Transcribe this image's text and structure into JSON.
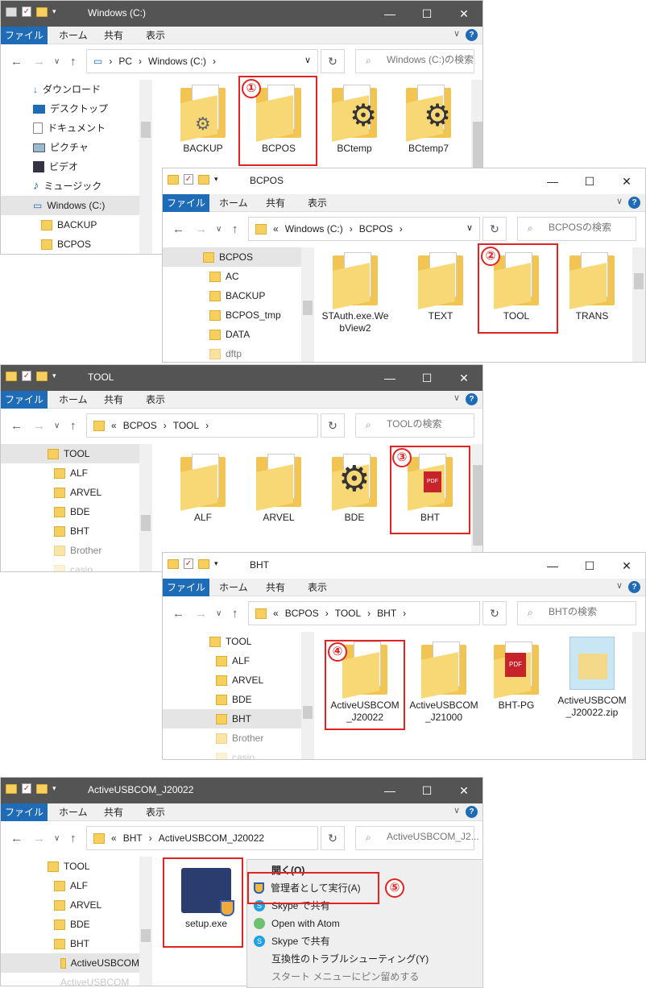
{
  "windows": [
    {
      "title": "Windows (C:)",
      "ribbon": [
        "ファイル",
        "ホーム",
        "共有",
        "表示"
      ],
      "path": [
        "PC",
        "Windows (C:)"
      ],
      "search_placeholder": "Windows (C:)の検索",
      "sidebar": [
        "ダウンロード",
        "デスクトップ",
        "ドキュメント",
        "ピクチャ",
        "ビデオ",
        "ミュージック",
        "Windows (C:)",
        "BACKUP",
        "BCPOS"
      ],
      "items": [
        "BACKUP",
        "BCPOS",
        "BCtemp",
        "BCtemp7"
      ]
    },
    {
      "title": "BCPOS",
      "ribbon": [
        "ファイル",
        "ホーム",
        "共有",
        "表示"
      ],
      "path": [
        "Windows (C:)",
        "BCPOS"
      ],
      "search_placeholder": "BCPOSの検索",
      "sidebar": [
        "BCPOS",
        "AC",
        "BACKUP",
        "BCPOS_tmp",
        "DATA",
        "dftp"
      ],
      "items": [
        "STAuth.exe.WebView2",
        "TEXT",
        "TOOL",
        "TRANS"
      ]
    },
    {
      "title": "TOOL",
      "ribbon": [
        "ファイル",
        "ホーム",
        "共有",
        "表示"
      ],
      "path": [
        "BCPOS",
        "TOOL"
      ],
      "search_placeholder": "TOOLの検索",
      "sidebar": [
        "TOOL",
        "ALF",
        "ARVEL",
        "BDE",
        "BHT",
        "Brother",
        "casio"
      ],
      "items": [
        "ALF",
        "ARVEL",
        "BDE",
        "BHT"
      ]
    },
    {
      "title": "BHT",
      "ribbon": [
        "ファイル",
        "ホーム",
        "共有",
        "表示"
      ],
      "path": [
        "BCPOS",
        "TOOL",
        "BHT"
      ],
      "search_placeholder": "BHTの検索",
      "sidebar": [
        "TOOL",
        "ALF",
        "ARVEL",
        "BDE",
        "BHT",
        "Brother",
        "casio"
      ],
      "items": [
        "ActiveUSBCOM_J20022",
        "ActiveUSBCOM_J21000",
        "BHT-PG",
        "ActiveUSBCOM_J20022.zip"
      ]
    },
    {
      "title": "ActiveUSBCOM_J20022",
      "ribbon": [
        "ファイル",
        "ホーム",
        "共有",
        "表示"
      ],
      "path": [
        "BHT",
        "ActiveUSBCOM_J20022"
      ],
      "search_placeholder": "ActiveUSBCOM_J2...",
      "sidebar": [
        "TOOL",
        "ALF",
        "ARVEL",
        "BDE",
        "BHT",
        "ActiveUSBCOM",
        "ActiveUSBCOM"
      ],
      "items": [
        "setup.exe"
      ]
    }
  ],
  "context_menu": [
    "開く(O)",
    "管理者として実行(A)",
    "Skype で共有",
    "Open with Atom",
    "Skype で共有",
    "互換性のトラブルシューティング(Y)",
    "スタート メニューにピン留めする"
  ],
  "steps": [
    "①",
    "②",
    "③",
    "④",
    "⑤"
  ],
  "accent": "#1e6cb8",
  "highlight": "#e32222"
}
